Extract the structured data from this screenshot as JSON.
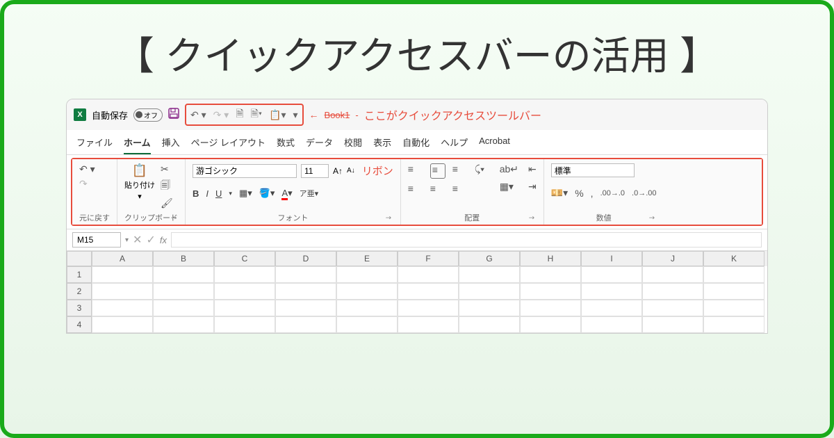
{
  "page_title": "【 クイックアクセスバーの活用 】",
  "titlebar": {
    "autosave_label": "自動保存",
    "autosave_state": "オフ",
    "book_label": "Book1",
    "annotation": "ここがクイックアクセスツールバー"
  },
  "tabs": [
    "ファイル",
    "ホーム",
    "挿入",
    "ページ レイアウト",
    "数式",
    "データ",
    "校閲",
    "表示",
    "自動化",
    "ヘルプ",
    "Acrobat"
  ],
  "active_tab_index": 1,
  "ribbon": {
    "undo_group": "元に戻す",
    "clipboard_group": "クリップボード",
    "paste_label": "貼り付け",
    "font_group": "フォント",
    "font_name": "游ゴシック",
    "font_size": "11",
    "ribbon_annotation": "リボン",
    "bold": "B",
    "italic": "I",
    "underline": "U",
    "align_group": "配置",
    "number_group": "数値",
    "number_format": "標準"
  },
  "formula_bar": {
    "name_box": "M15",
    "fx_label": "fx"
  },
  "columns": [
    "A",
    "B",
    "C",
    "D",
    "E",
    "F",
    "G",
    "H",
    "I",
    "J",
    "K"
  ],
  "rows": [
    "1",
    "2",
    "3",
    "4"
  ]
}
